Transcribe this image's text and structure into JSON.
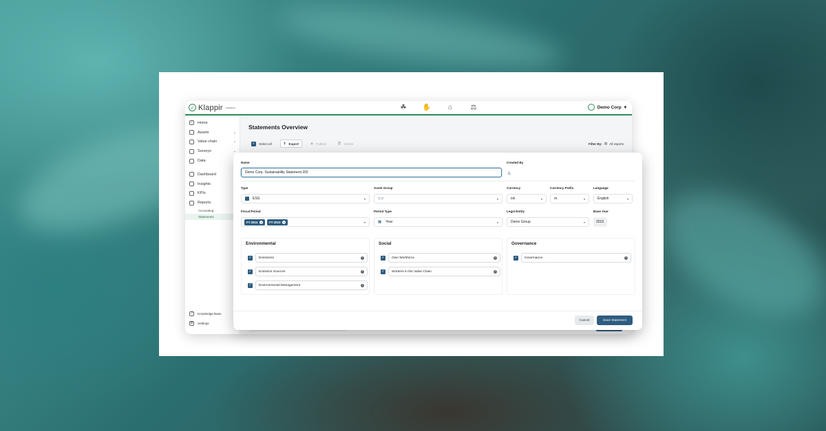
{
  "app": {
    "logo": "Klappir",
    "logo_sup": "PREMIUM",
    "org": "Demo Corp",
    "top_icons": [
      "hand-leaf-icon",
      "hands-icon",
      "factory-icon",
      "scale-icon"
    ]
  },
  "sidebar": {
    "items": [
      {
        "label": "Home",
        "icon": "home-icon"
      },
      {
        "label": "Assets",
        "icon": "assets-icon",
        "chev": "⌄"
      },
      {
        "label": "Value chain",
        "icon": "value-chain-icon",
        "chev": "⌄"
      },
      {
        "label": "Surveys",
        "icon": "surveys-icon",
        "chev": "⌄"
      },
      {
        "label": "Data",
        "icon": "data-icon"
      },
      {
        "label": "Dashboard",
        "icon": "dashboard-icon"
      },
      {
        "label": "Insights",
        "icon": "insights-icon"
      },
      {
        "label": "KPIs",
        "icon": "kpis-icon"
      },
      {
        "label": "Reports",
        "icon": "reports-icon",
        "chev": "⌃"
      }
    ],
    "subitems": [
      "Accounting",
      "Statements"
    ],
    "bottom": [
      {
        "label": "Knowledge Base",
        "icon": "help-icon"
      },
      {
        "label": "Settings",
        "icon": "gear-icon"
      }
    ]
  },
  "main": {
    "title": "Statements Overview",
    "select_all": "Select all",
    "export": "Export",
    "publish": "Publish",
    "delete": "Delete",
    "filter_by": "Filter By:",
    "filter_value": "All reports"
  },
  "modal": {
    "name_label": "Name",
    "name_value": "Demo Corp. Sustainability Statement 202",
    "created_by_label": "Created By",
    "type_label": "Type",
    "type_value": "ESG",
    "asset_group_label": "Asset Group",
    "asset_group_value": "",
    "currency_label": "Currency",
    "currency_value": "isk",
    "currency_prefix_label": "Currency Prefix",
    "currency_prefix_value": "m.",
    "language_label": "Language",
    "language_value": "English",
    "fiscal_period_label": "Fiscal Period",
    "fiscal_period_tags": [
      "FY 2024",
      "FY 2023"
    ],
    "period_type_label": "Period Type",
    "period_type_value": "Year",
    "legal_entity_label": "Legal Entity",
    "legal_entity_value": "Demo Group",
    "base_year_label": "Base Year",
    "base_year_value": "2015",
    "sections": [
      {
        "title": "Environmental",
        "topics": [
          "Emissions",
          "Emission Sources",
          "Environmental Management"
        ]
      },
      {
        "title": "Social",
        "topics": [
          "Own Workforce",
          "Workers in the Value Chain"
        ]
      },
      {
        "title": "Governance",
        "topics": [
          "Governance"
        ]
      }
    ],
    "cancel": "Cancel",
    "save": "Save Statement"
  },
  "colors": {
    "accent": "#2e5c80",
    "brand_green": "#2e8b57"
  }
}
